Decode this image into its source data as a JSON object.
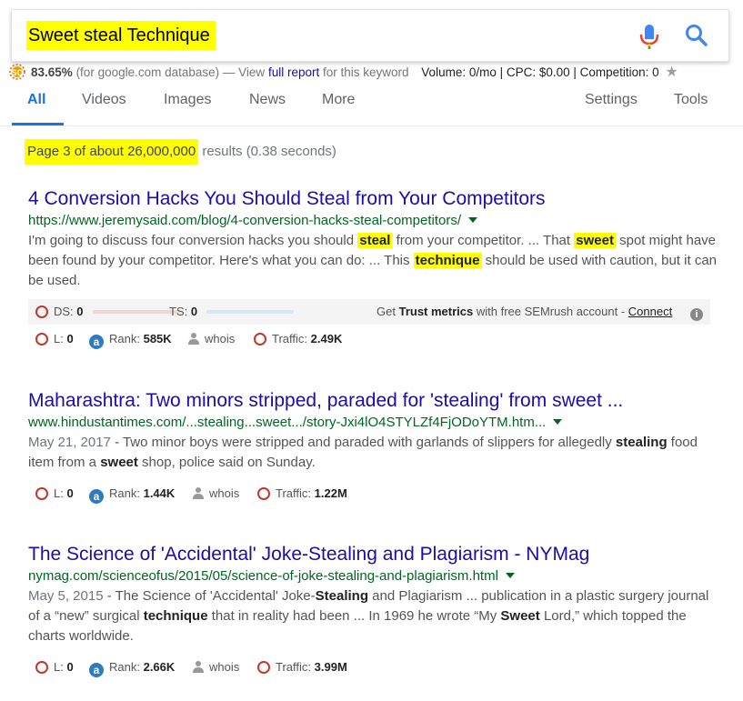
{
  "search": {
    "query": "Sweet steal Technique"
  },
  "seo_bar": {
    "score": "83.65%",
    "database_text": "(for google.com database) — View",
    "report_link": "full report",
    "report_suffix": "for this keyword",
    "metrics": "Volume: 0/mo | CPC: $0.00 | Competition: 0"
  },
  "tabs": [
    {
      "label": "All"
    },
    {
      "label": "Videos"
    },
    {
      "label": "Images"
    },
    {
      "label": "News"
    },
    {
      "label": "More"
    },
    {
      "label": "Settings"
    },
    {
      "label": "Tools"
    }
  ],
  "stats": {
    "highlighted": "Page 3 of about 26,000,000",
    "rest": "results (0.38 seconds)"
  },
  "colors": {
    "link": "#1a0dab",
    "url": "#006621",
    "highlight": "#ffff00",
    "accent": "#1a73e8"
  },
  "results": [
    {
      "title": "4 Conversion Hacks You Should Steal from Your Competitors",
      "url": "https://www.jeremysaid.com/blog/4-conversion-hacks-steal-competitors/",
      "snippet": [
        {
          "t": "I'm going to discuss four conversion hacks you should "
        },
        {
          "t": "steal",
          "hl": true
        },
        {
          "t": " from your competitor. ... That "
        },
        {
          "t": "sweet",
          "hl": true
        },
        {
          "t": " spot might have been found by your competitor. Here's what you can do: ... This "
        },
        {
          "t": "technique",
          "hl": true
        },
        {
          "t": " should be used with caution, but it can be used."
        }
      ],
      "ds_label": "DS:",
      "ds_value": "0",
      "ts_label": "TS:",
      "ts_value": "0",
      "trust_prefix": "Get",
      "trust_bold": "Trust metrics",
      "trust_suffix": "with free SEMrush account -",
      "trust_link": "Connect",
      "l_label": "L:",
      "l_value": "0",
      "rank_label": "Rank:",
      "rank_value": "585K",
      "whois": "whois",
      "traffic_label": "Traffic:",
      "traffic_value": "2.49K"
    },
    {
      "title": "Maharashtra: Two minors stripped, paraded for 'stealing' from sweet ...",
      "url": "www.hindustantimes.com/...stealing...sweet.../story-Jxi4lO4STYLZf4FjODoYTM.htm...",
      "date": "May 21, 2017",
      "snippet": [
        {
          "t": " - Two minor boys were stripped and paraded with garlands of slippers for allegedly "
        },
        {
          "t": "stealing",
          "b": true
        },
        {
          "t": " food item from a "
        },
        {
          "t": "sweet",
          "b": true
        },
        {
          "t": " shop, police said on Sunday."
        }
      ],
      "l_label": "L:",
      "l_value": "0",
      "rank_label": "Rank:",
      "rank_value": "1.44K",
      "whois": "whois",
      "traffic_label": "Traffic:",
      "traffic_value": "1.22M"
    },
    {
      "title": "The Science of 'Accidental' Joke-Stealing and Plagiarism - NYMag",
      "url": "nymag.com/scienceofus/2015/05/science-of-joke-stealing-and-plagiarism.html",
      "date": "May 5, 2015",
      "snippet": [
        {
          "t": " - The Science of 'Accidental' Joke-"
        },
        {
          "t": "Stealing",
          "b": true
        },
        {
          "t": " and Plagiarism ... publication in a plastic surgery journal of a “new” surgical "
        },
        {
          "t": "technique",
          "b": true
        },
        {
          "t": " that in reality had been ... In 1969 he wrote “My "
        },
        {
          "t": "Sweet",
          "b": true
        },
        {
          "t": " Lord,” which topped the charts worldwide."
        }
      ],
      "l_label": "L:",
      "l_value": "0",
      "rank_label": "Rank:",
      "rank_value": "2.66K",
      "whois": "whois",
      "traffic_label": "Traffic:",
      "traffic_value": "3.99M"
    }
  ]
}
